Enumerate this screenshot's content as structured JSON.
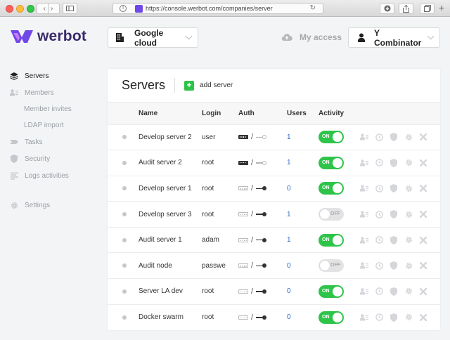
{
  "browser": {
    "url": "https://console.werbot.com/companies/server"
  },
  "header": {
    "logo_text": "werbot",
    "project_selector": "Google cloud",
    "my_access": "My access",
    "org_selector": "Y Combinator"
  },
  "sidebar": {
    "items": [
      {
        "label": "Servers",
        "icon": "layers-icon",
        "active": true
      },
      {
        "label": "Members",
        "icon": "members-icon"
      },
      {
        "label": "Member invites",
        "sub": true
      },
      {
        "label": "LDAP import",
        "sub": true
      },
      {
        "label": "Tasks",
        "icon": "tasks-icon"
      },
      {
        "label": "Security",
        "icon": "shield-icon"
      },
      {
        "label": "Logs activities",
        "icon": "logs-icon"
      },
      {
        "label": "Settings",
        "icon": "gear-icon"
      }
    ]
  },
  "main": {
    "title": "Servers",
    "add_label": "add server",
    "columns": [
      "Name",
      "Login",
      "Auth",
      "Users",
      "Activity"
    ],
    "rows": [
      {
        "name": "Develop server 2",
        "login": "user",
        "password_auth": true,
        "key_auth": false,
        "users": "1",
        "activity": "ON"
      },
      {
        "name": "Audit server 2",
        "login": "root",
        "password_auth": true,
        "key_auth": false,
        "users": "1",
        "activity": "ON"
      },
      {
        "name": "Develop server 1",
        "login": "root",
        "password_auth": false,
        "key_auth": true,
        "users": "0",
        "activity": "ON"
      },
      {
        "name": "Develop server 3",
        "login": "root",
        "password_auth": false,
        "key_auth": true,
        "users": "1",
        "activity": "OFF"
      },
      {
        "name": "Audit server 1",
        "login": "adam",
        "password_auth": false,
        "key_auth": true,
        "users": "1",
        "activity": "ON"
      },
      {
        "name": "Audit node",
        "login": "passwe",
        "password_auth": false,
        "key_auth": true,
        "users": "0",
        "activity": "OFF"
      },
      {
        "name": "Server LA dev",
        "login": "root",
        "password_auth": false,
        "key_auth": true,
        "users": "0",
        "activity": "ON"
      },
      {
        "name": "Docker swarm",
        "login": "root",
        "password_auth": false,
        "key_auth": true,
        "users": "0",
        "activity": "ON"
      }
    ],
    "row_actions": [
      "members-icon",
      "clock-icon",
      "shield-icon",
      "gear-icon",
      "close-icon"
    ]
  },
  "colors": {
    "accent_green": "#2ec44a",
    "link_blue": "#2b6cc4",
    "brand_purple": "#7048e8"
  }
}
